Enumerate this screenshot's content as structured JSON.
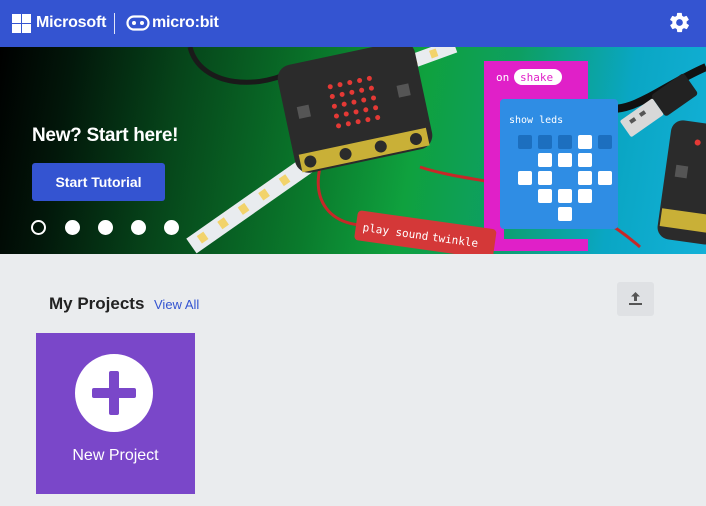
{
  "header": {
    "brand": "Microsoft",
    "product": "micro:bit",
    "settings_icon": "gear-icon",
    "bg_color": "#3454d1"
  },
  "hero": {
    "title": "New? Start here!",
    "button_label": "Start Tutorial",
    "carousel_total": 5,
    "carousel_active": 1,
    "blocks": {
      "event": "on",
      "event_dropdown": "shake",
      "show_leds": "show leds",
      "play_sound": "play sound",
      "sound_name": "twinkle"
    }
  },
  "projects": {
    "title": "My Projects",
    "view_all": "View All",
    "import_icon": "upload-icon",
    "new_project_label": "New Project",
    "new_project_icon": "plus-icon",
    "card_color": "#7a47c9"
  }
}
